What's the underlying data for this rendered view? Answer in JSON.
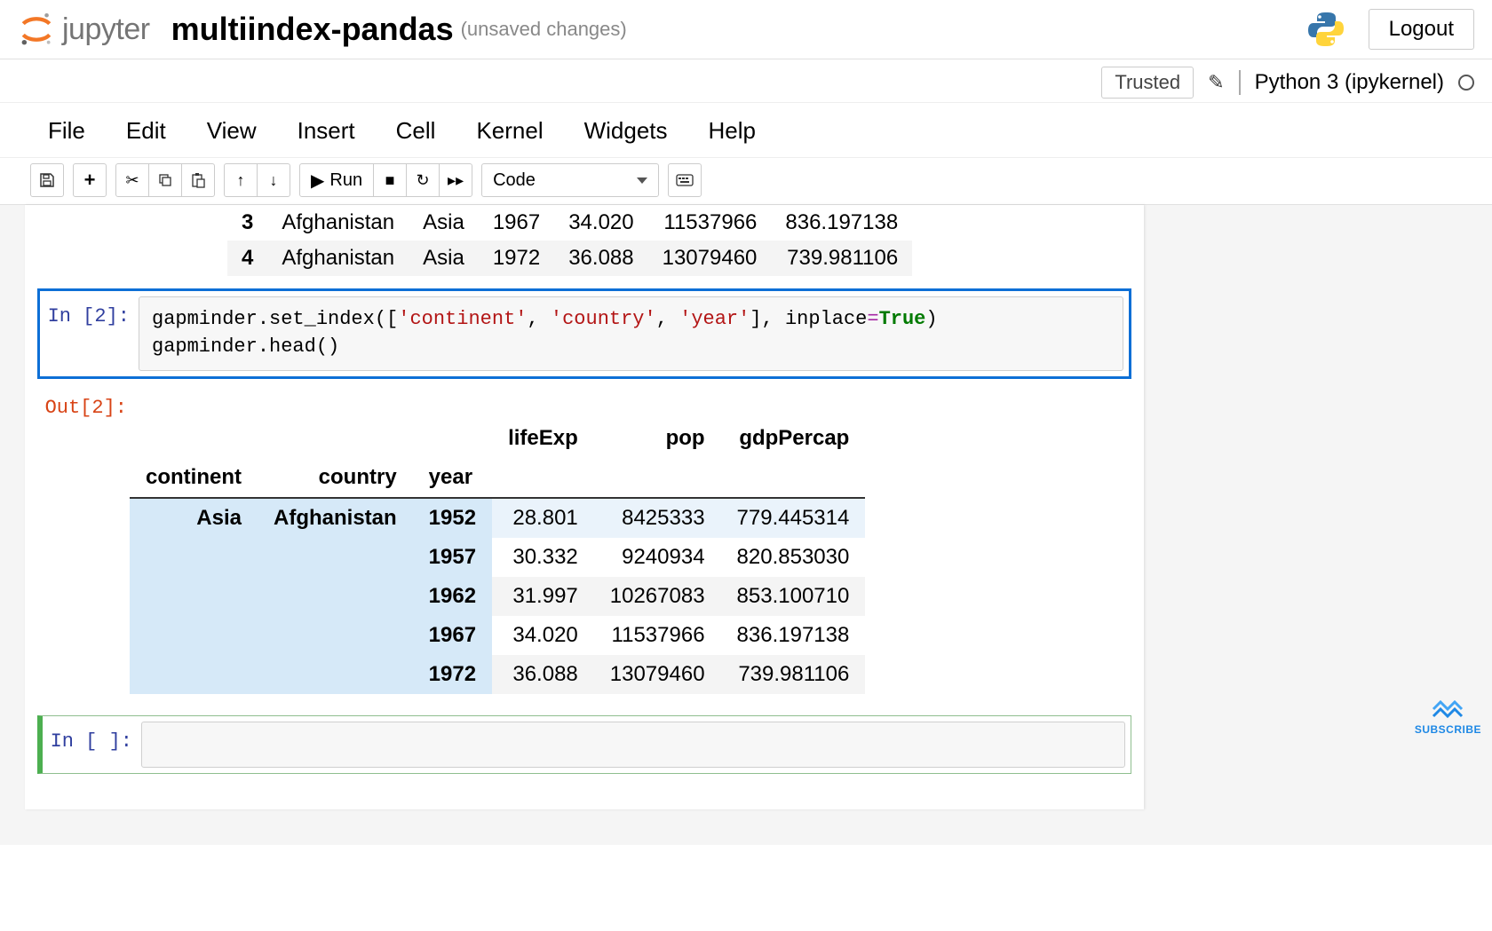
{
  "header": {
    "logo_text": "jupyter",
    "notebook_name": "multiindex-pandas",
    "unsaved": "(unsaved changes)",
    "logout": "Logout"
  },
  "toolbar": {
    "trusted": "Trusted",
    "kernel": "Python 3 (ipykernel)"
  },
  "menubar": {
    "file": "File",
    "edit": "Edit",
    "view": "View",
    "insert": "Insert",
    "cell": "Cell",
    "kernel": "Kernel",
    "widgets": "Widgets",
    "help": "Help"
  },
  "iconbar": {
    "run": "Run",
    "celltype": "Code"
  },
  "top_table": {
    "rows": [
      {
        "idx": "3",
        "country": "Afghanistan",
        "continent": "Asia",
        "year": "1967",
        "lifeExp": "34.020",
        "pop": "11537966",
        "gdp": "836.197138"
      },
      {
        "idx": "4",
        "country": "Afghanistan",
        "continent": "Asia",
        "year": "1972",
        "lifeExp": "36.088",
        "pop": "13079460",
        "gdp": "739.981106"
      }
    ]
  },
  "cell2": {
    "in_label": "In [2]:",
    "out_label": "Out[2]:",
    "code_p1": "gapminder.set_index([",
    "code_s1": "'continent'",
    "code_c1": ", ",
    "code_s2": "'country'",
    "code_c2": ", ",
    "code_s3": "'year'",
    "code_p2": "], inplace",
    "code_eq": "=",
    "code_true": "True",
    "code_p3": ")",
    "code_line2": "gapminder.head()"
  },
  "out2_headers": {
    "lifeExp": "lifeExp",
    "pop": "pop",
    "gdp": "gdpPercap",
    "continent": "continent",
    "country": "country",
    "year": "year"
  },
  "out2_rows": [
    {
      "continent": "Asia",
      "country": "Afghanistan",
      "year": "1952",
      "lifeExp": "28.801",
      "pop": "8425333",
      "gdp": "779.445314"
    },
    {
      "continent": "",
      "country": "",
      "year": "1957",
      "lifeExp": "30.332",
      "pop": "9240934",
      "gdp": "820.853030"
    },
    {
      "continent": "",
      "country": "",
      "year": "1962",
      "lifeExp": "31.997",
      "pop": "10267083",
      "gdp": "853.100710"
    },
    {
      "continent": "",
      "country": "",
      "year": "1967",
      "lifeExp": "34.020",
      "pop": "11537966",
      "gdp": "836.197138"
    },
    {
      "continent": "",
      "country": "",
      "year": "1972",
      "lifeExp": "36.088",
      "pop": "13079460",
      "gdp": "739.981106"
    }
  ],
  "cell3": {
    "in_label": "In [ ]:"
  },
  "subscribe": "SUBSCRIBE"
}
